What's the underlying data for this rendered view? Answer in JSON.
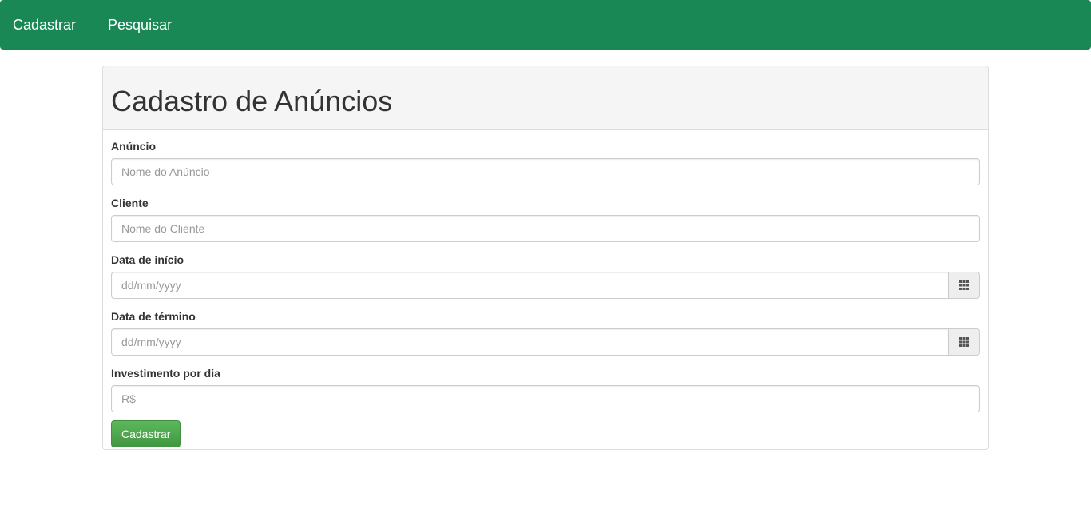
{
  "navbar": {
    "background_color": "#198855",
    "items": [
      {
        "label": "Cadastrar"
      },
      {
        "label": "Pesquisar"
      }
    ]
  },
  "panel": {
    "title": "Cadastro de Anúncios"
  },
  "form": {
    "anuncio": {
      "label": "Anúncio",
      "placeholder": "Nome do Anúncio",
      "value": ""
    },
    "cliente": {
      "label": "Cliente",
      "placeholder": "Nome do Cliente",
      "value": ""
    },
    "data_inicio": {
      "label": "Data de início",
      "placeholder": "dd/mm/yyyy",
      "value": "",
      "icon": "calendar-grid-icon"
    },
    "data_termino": {
      "label": "Data de término",
      "placeholder": "dd/mm/yyyy",
      "value": "",
      "icon": "calendar-grid-icon"
    },
    "investimento": {
      "label": "Investimento por dia",
      "placeholder": "R$",
      "value": ""
    },
    "submit_label": "Cadastrar",
    "submit_color": "#5cb85c"
  }
}
